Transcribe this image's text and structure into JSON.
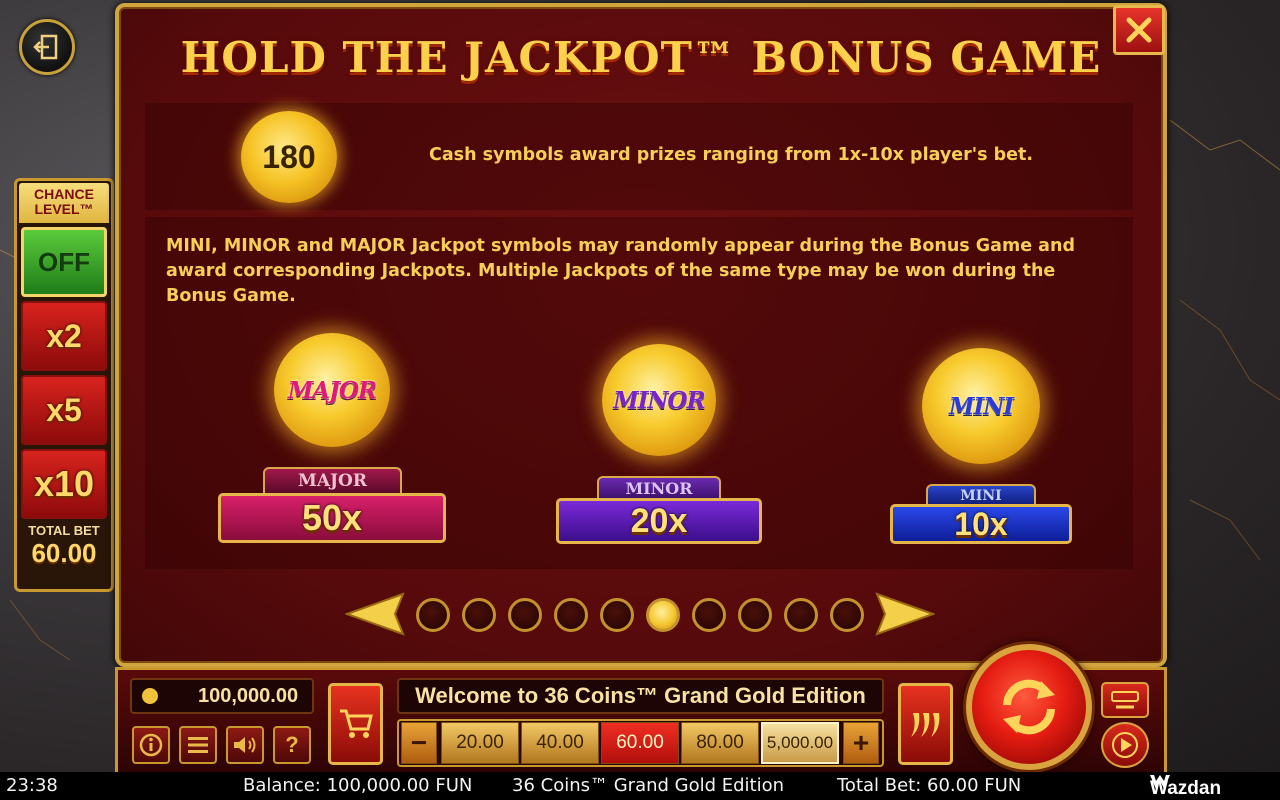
{
  "title": "HOLD THE JACKPOT™ BONUS GAME",
  "cash": {
    "coin_value": "180",
    "text": "Cash symbols award prizes ranging from 1x-10x player's bet."
  },
  "jackpot_text": "MINI, MINOR and MAJOR Jackpot symbols may randomly appear during the Bonus Game and award corresponding Jackpots. Multiple Jackpots of the same type may be won during the Bonus Game.",
  "jackpots": [
    {
      "coin_label": "MAJOR",
      "tab_label": "MAJOR",
      "multiplier": "50x",
      "color": "#b8124e"
    },
    {
      "coin_label": "MINOR",
      "tab_label": "MINOR",
      "multiplier": "20x",
      "color": "#5c1aa8"
    },
    {
      "coin_label": "MINI",
      "tab_label": "MINI",
      "multiplier": "10x",
      "color": "#1830b8"
    }
  ],
  "pagination": {
    "total": 10,
    "active_index": 5
  },
  "chance_level": {
    "title": "CHANCE LEVEL™",
    "options": [
      "OFF",
      "x2",
      "x5",
      "x10"
    ],
    "selected": "OFF",
    "total_bet_label": "TOTAL BET",
    "total_bet_value": "60.00"
  },
  "controls": {
    "balance": "100,000.00",
    "welcome": "Welcome to 36 Coins™ Grand Gold Edition",
    "bets": [
      "20.00",
      "40.00",
      "60.00",
      "80.00",
      "5,000.00"
    ],
    "selected_bet": "60.00",
    "minus": "−",
    "plus": "+",
    "help": "?"
  },
  "status_bar": {
    "time": "23:38",
    "balance": "Balance: 100,000.00 FUN",
    "game": "36 Coins™ Grand Gold Edition",
    "total_bet": "Total Bet: 60.00 FUN",
    "brand": "Wazdan"
  },
  "colors": {
    "accent_gold": "#fbd04b",
    "panel_red": "#560a0b",
    "frame_gold": "#d1a43e"
  }
}
